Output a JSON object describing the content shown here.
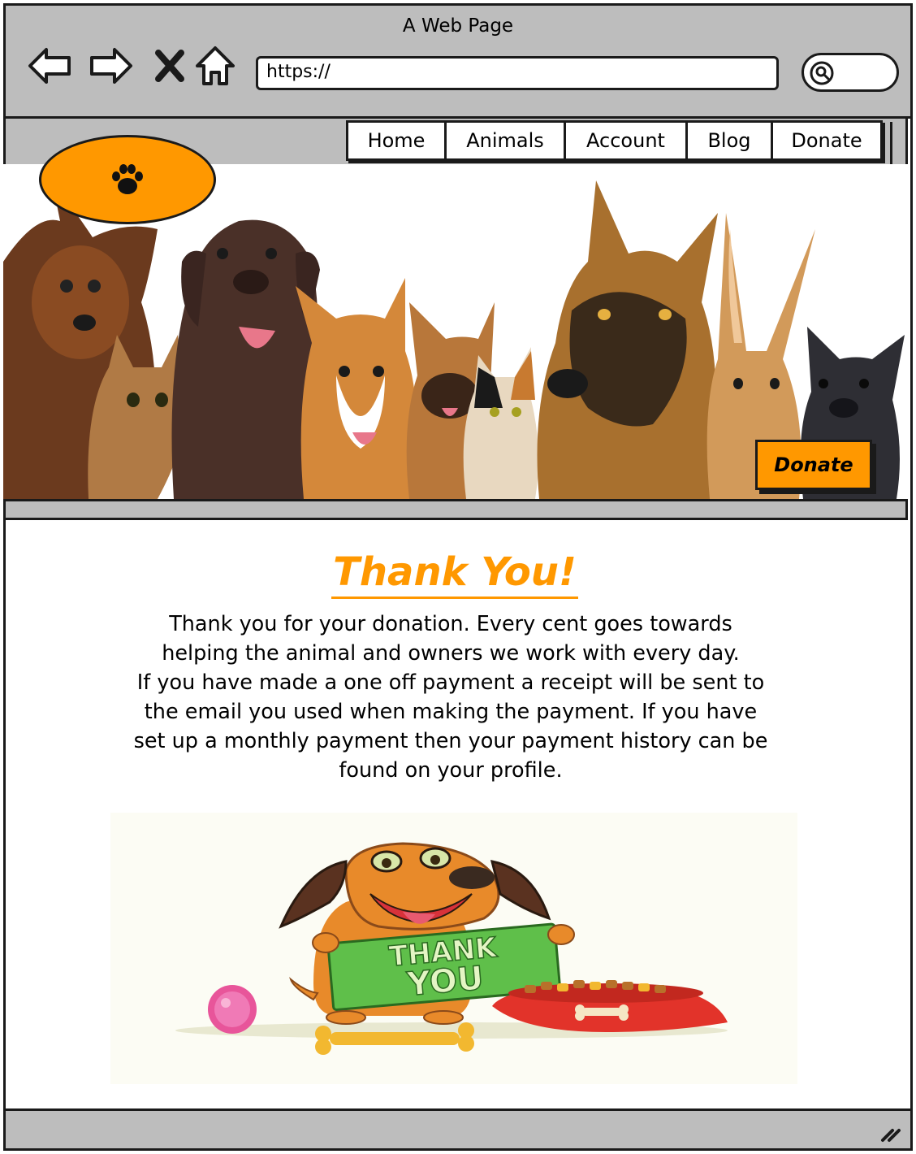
{
  "window": {
    "title": "A Web Page"
  },
  "browser": {
    "url": "https://",
    "back_icon": "back-arrow-icon",
    "forward_icon": "forward-arrow-icon",
    "close_icon": "close-icon",
    "home_icon": "home-icon",
    "search_icon": "search-icon"
  },
  "nav": {
    "items": [
      {
        "label": "Home"
      },
      {
        "label": "Animals"
      },
      {
        "label": "Account"
      },
      {
        "label": "Blog"
      },
      {
        "label": "Donate"
      }
    ]
  },
  "logo": {
    "icon": "paw-icon",
    "color": "#ff9800"
  },
  "hero": {
    "donate_label": "Donate",
    "image": "pets-group-banner"
  },
  "main": {
    "title": "Thank You!",
    "message_lines": [
      "Thank you for your donation. Every cent goes towards",
      "helping the animal and owners we work with every day.",
      "If you have made a one off payment a receipt will be sent to",
      "the email you used when making the payment. If you have",
      "set up a monthly payment then your payment history can be",
      "found on your profile."
    ],
    "illustration": {
      "sign_line1": "THANK",
      "sign_line2": "YOU"
    }
  },
  "colors": {
    "accent": "#ff9800",
    "chrome": "#bdbdbd",
    "ink": "#1a1a1a"
  }
}
